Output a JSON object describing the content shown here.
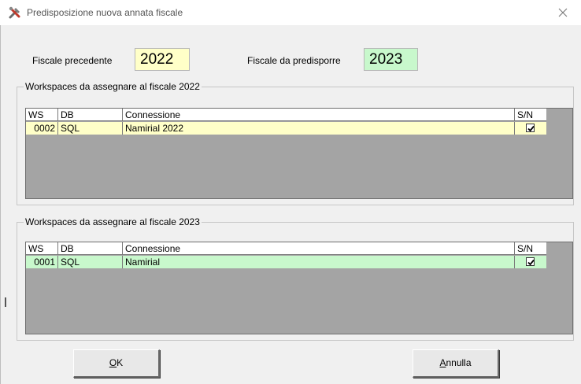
{
  "window": {
    "title": "Predisposizione nuova annata fiscale",
    "icon": "tools-icon"
  },
  "years": {
    "prev_label": "Fiscale precedente",
    "prev_value": "2022",
    "next_label": "Fiscale da predisporre",
    "next_value": "2023"
  },
  "group1": {
    "title": "Workspaces da assegnare al fiscale 2022",
    "columns": [
      "WS",
      "DB",
      "Connessione",
      "S/N"
    ],
    "rows": [
      {
        "ws": "0002",
        "db": "SQL",
        "conn": "Namirial 2022",
        "checked": true
      }
    ]
  },
  "group2": {
    "title": "Workspaces da assegnare al fiscale 2023",
    "columns": [
      "WS",
      "DB",
      "Connessione",
      "S/N"
    ],
    "rows": [
      {
        "ws": "0001",
        "db": "SQL",
        "conn": "Namirial",
        "checked": true
      }
    ]
  },
  "buttons": {
    "ok_mnemonic": "O",
    "ok_rest": "K",
    "cancel_mnemonic": "A",
    "cancel_rest": "nnulla"
  },
  "colors": {
    "prev_year_bg": "#ffffc8",
    "next_year_bg": "#c8f8cc",
    "grid_bg": "#a4a4a4"
  }
}
